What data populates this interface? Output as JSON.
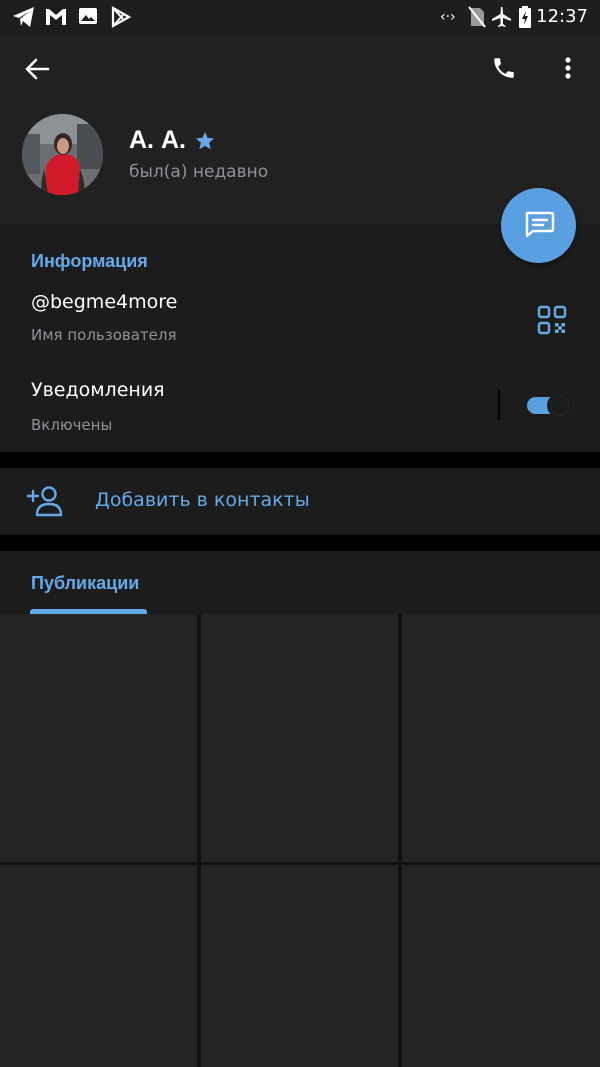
{
  "status_bar": {
    "time": "12:37",
    "left_icons": [
      "telegram-icon",
      "gmail-icon",
      "gallery-icon",
      "play-store-icon"
    ],
    "right_icons": [
      "data-saver-icon",
      "no-sim-icon",
      "airplane-icon",
      "battery-charging-icon"
    ]
  },
  "toolbar": {
    "back_icon": "arrow-left-icon",
    "call_icon": "phone-icon",
    "more_icon": "more-vert-icon"
  },
  "profile": {
    "name": "А. А.",
    "status": "был(а) недавно",
    "badge_icon": "premium-star-icon"
  },
  "fab": {
    "icon": "message-icon"
  },
  "info": {
    "title": "Информация",
    "username": "@begme4more",
    "username_caption": "Имя пользователя",
    "qr_icon": "qr-code-icon",
    "notifications_label": "Уведомления",
    "notifications_status": "Включены",
    "notifications_enabled": true
  },
  "add_contact": {
    "label": "Добавить в контакты",
    "icon": "add-person-icon"
  },
  "publications": {
    "title": "Публикации"
  },
  "colors": {
    "accent": "#64a9ea",
    "fab": "#5a9fe0",
    "background": "#1c1c1c",
    "header": "#212121",
    "secondary_text": "#8e9399"
  }
}
